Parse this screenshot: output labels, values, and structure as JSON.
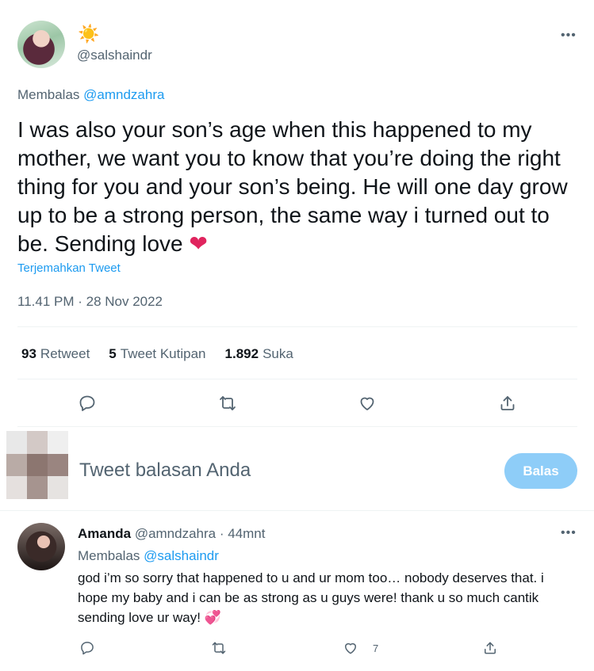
{
  "main_tweet": {
    "sun_emoji": "☀️",
    "handle": "@salshaindr",
    "more_label": "•••",
    "replying_prefix": "Membalas ",
    "replying_to": "@amndzahra",
    "text": "I was also your son’s age when this happened to my mother, we want you to know that you’re doing the right thing for you and your son’s being. He will one day grow up to be a strong person, the same way i turned out to be. Sending love ",
    "heart_emoji": "❤",
    "translate_label": "Terjemahkan Tweet",
    "timestamp": "11.41 PM · 28 Nov 2022",
    "stats": {
      "retweets_count": "93",
      "retweets_label": "Retweet",
      "quotes_count": "5",
      "quotes_label": "Tweet Kutipan",
      "likes_count": "1.892",
      "likes_label": "Suka"
    },
    "actions": [
      "reply-icon",
      "retweet-icon",
      "like-icon",
      "share-icon"
    ]
  },
  "composer": {
    "placeholder": "Tweet balasan Anda",
    "button_label": "Balas",
    "button_color": "#8ecdf8",
    "avatar_pixel_colors": [
      "#e8e8e8",
      "#d3c9c6",
      "#efefef",
      "#b9aba6",
      "#8c7670",
      "#9a8580",
      "#e5e0de",
      "#a6948f",
      "#e6e3e1"
    ]
  },
  "reply_tweet": {
    "name": "Amanda",
    "handle": "@amndzahra",
    "separator": " · ",
    "time": "44mnt",
    "more_label": "•••",
    "replying_prefix": "Membalas ",
    "replying_to": "@salshaindr",
    "text": "god i’m so sorry that happened to u and ur mom too… nobody deserves that. i hope my baby and i can be as strong as u guys were! thank u so much cantik sending love ur way! ",
    "emoji": "💞",
    "like_count": "7",
    "actions": [
      "reply-icon",
      "retweet-icon",
      "like-icon",
      "share-icon"
    ]
  },
  "colors": {
    "accent": "#1d9bf0",
    "secondary_text": "#536471",
    "primary_text": "#0f1419",
    "heart": "#e0245e"
  }
}
